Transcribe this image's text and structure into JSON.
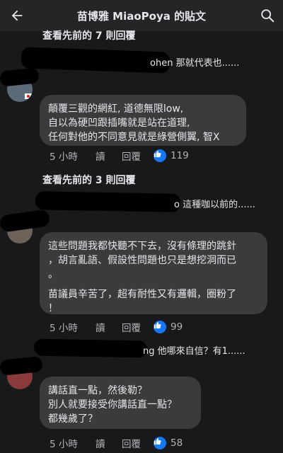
{
  "header": {
    "title": "苗博雅 MiaoPoya 的貼文",
    "back_icon": "arrow-left-icon",
    "search_icon": "search-icon"
  },
  "thread1": {
    "more_replies": "查看先前的 7 則回覆",
    "collapsed_text": "ohen 那就代表也......",
    "comment_lines": [
      "顛覆三觀的網紅, 道德無限low,",
      "自以為硬凹跟插嘴就是站在道理,",
      "任何對他的不同意見就是綠營側翼, 智X"
    ],
    "time": "5 小時",
    "read": "讀",
    "reply": "回覆",
    "likes": "119"
  },
  "thread2": {
    "more_replies": "查看先前的 3 則回覆",
    "collapsed_text": "o 這種咖以前的......",
    "comment_lines": [
      "這些問題我都快聽不下去，沒有條理的跳針",
      "，胡言亂語、假設性問題也只是想挖洞而已",
      "。",
      "苗議員辛苦了，超有耐性又有邏輯，圈粉了",
      "！"
    ],
    "time": "5 小時",
    "read": "讀",
    "reply": "回覆",
    "likes": "99"
  },
  "thread3": {
    "collapsed_text": "ng 他哪來自信？有1......",
    "comment_lines": [
      "講話直一點，然後勒？",
      "別人就要接受你講話直一點？",
      "都幾歲了？"
    ],
    "time": "5 小時",
    "read": "讀",
    "reply": "回覆",
    "likes": "58"
  },
  "colors": {
    "background": "#18191a",
    "bubble": "#3a3b3c",
    "like_blue": "#1877f2",
    "muted": "#b0b3b8"
  }
}
